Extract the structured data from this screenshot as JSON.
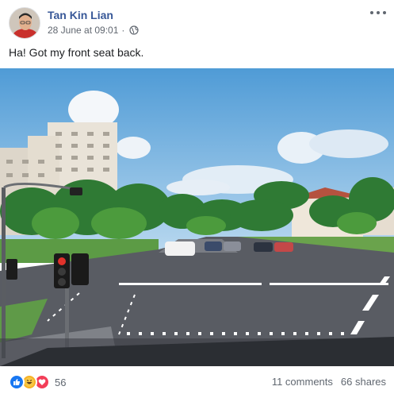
{
  "post": {
    "author": "Tan Kin Lian",
    "timestamp": "28 June at 09:01",
    "separator": "·",
    "privacy_icon": "globe-icon",
    "menu_icon": "more-options-icon",
    "text": "Ha! Got my front seat back."
  },
  "footer": {
    "reactions": [
      "like",
      "haha",
      "love"
    ],
    "reaction_count": "56",
    "comments": "11 comments",
    "shares": "66 shares"
  },
  "colors": {
    "author_link": "#385898",
    "secondary_text": "#616770",
    "like": "#1877f2",
    "haha": "#f7b125",
    "love": "#f33e58"
  }
}
